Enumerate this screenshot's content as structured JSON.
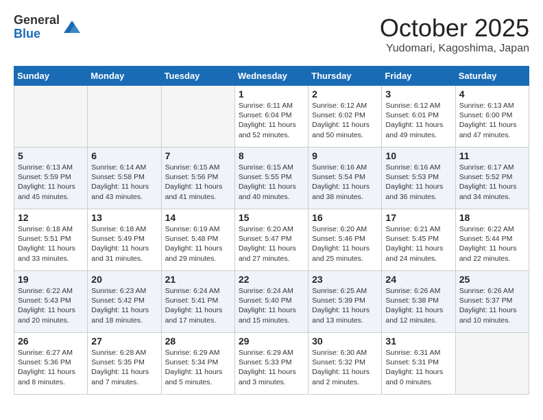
{
  "header": {
    "logo_general": "General",
    "logo_blue": "Blue",
    "month_title": "October 2025",
    "location": "Yudomari, Kagoshima, Japan"
  },
  "days": [
    "Sunday",
    "Monday",
    "Tuesday",
    "Wednesday",
    "Thursday",
    "Friday",
    "Saturday"
  ],
  "weeks": [
    [
      {
        "date": "",
        "sunrise": "",
        "sunset": "",
        "daylight": ""
      },
      {
        "date": "",
        "sunrise": "",
        "sunset": "",
        "daylight": ""
      },
      {
        "date": "",
        "sunrise": "",
        "sunset": "",
        "daylight": ""
      },
      {
        "date": "1",
        "sunrise": "Sunrise: 6:11 AM",
        "sunset": "Sunset: 6:04 PM",
        "daylight": "Daylight: 11 hours and 52 minutes."
      },
      {
        "date": "2",
        "sunrise": "Sunrise: 6:12 AM",
        "sunset": "Sunset: 6:02 PM",
        "daylight": "Daylight: 11 hours and 50 minutes."
      },
      {
        "date": "3",
        "sunrise": "Sunrise: 6:12 AM",
        "sunset": "Sunset: 6:01 PM",
        "daylight": "Daylight: 11 hours and 49 minutes."
      },
      {
        "date": "4",
        "sunrise": "Sunrise: 6:13 AM",
        "sunset": "Sunset: 6:00 PM",
        "daylight": "Daylight: 11 hours and 47 minutes."
      }
    ],
    [
      {
        "date": "5",
        "sunrise": "Sunrise: 6:13 AM",
        "sunset": "Sunset: 5:59 PM",
        "daylight": "Daylight: 11 hours and 45 minutes."
      },
      {
        "date": "6",
        "sunrise": "Sunrise: 6:14 AM",
        "sunset": "Sunset: 5:58 PM",
        "daylight": "Daylight: 11 hours and 43 minutes."
      },
      {
        "date": "7",
        "sunrise": "Sunrise: 6:15 AM",
        "sunset": "Sunset: 5:56 PM",
        "daylight": "Daylight: 11 hours and 41 minutes."
      },
      {
        "date": "8",
        "sunrise": "Sunrise: 6:15 AM",
        "sunset": "Sunset: 5:55 PM",
        "daylight": "Daylight: 11 hours and 40 minutes."
      },
      {
        "date": "9",
        "sunrise": "Sunrise: 6:16 AM",
        "sunset": "Sunset: 5:54 PM",
        "daylight": "Daylight: 11 hours and 38 minutes."
      },
      {
        "date": "10",
        "sunrise": "Sunrise: 6:16 AM",
        "sunset": "Sunset: 5:53 PM",
        "daylight": "Daylight: 11 hours and 36 minutes."
      },
      {
        "date": "11",
        "sunrise": "Sunrise: 6:17 AM",
        "sunset": "Sunset: 5:52 PM",
        "daylight": "Daylight: 11 hours and 34 minutes."
      }
    ],
    [
      {
        "date": "12",
        "sunrise": "Sunrise: 6:18 AM",
        "sunset": "Sunset: 5:51 PM",
        "daylight": "Daylight: 11 hours and 33 minutes."
      },
      {
        "date": "13",
        "sunrise": "Sunrise: 6:18 AM",
        "sunset": "Sunset: 5:49 PM",
        "daylight": "Daylight: 11 hours and 31 minutes."
      },
      {
        "date": "14",
        "sunrise": "Sunrise: 6:19 AM",
        "sunset": "Sunset: 5:48 PM",
        "daylight": "Daylight: 11 hours and 29 minutes."
      },
      {
        "date": "15",
        "sunrise": "Sunrise: 6:20 AM",
        "sunset": "Sunset: 5:47 PM",
        "daylight": "Daylight: 11 hours and 27 minutes."
      },
      {
        "date": "16",
        "sunrise": "Sunrise: 6:20 AM",
        "sunset": "Sunset: 5:46 PM",
        "daylight": "Daylight: 11 hours and 25 minutes."
      },
      {
        "date": "17",
        "sunrise": "Sunrise: 6:21 AM",
        "sunset": "Sunset: 5:45 PM",
        "daylight": "Daylight: 11 hours and 24 minutes."
      },
      {
        "date": "18",
        "sunrise": "Sunrise: 6:22 AM",
        "sunset": "Sunset: 5:44 PM",
        "daylight": "Daylight: 11 hours and 22 minutes."
      }
    ],
    [
      {
        "date": "19",
        "sunrise": "Sunrise: 6:22 AM",
        "sunset": "Sunset: 5:43 PM",
        "daylight": "Daylight: 11 hours and 20 minutes."
      },
      {
        "date": "20",
        "sunrise": "Sunrise: 6:23 AM",
        "sunset": "Sunset: 5:42 PM",
        "daylight": "Daylight: 11 hours and 18 minutes."
      },
      {
        "date": "21",
        "sunrise": "Sunrise: 6:24 AM",
        "sunset": "Sunset: 5:41 PM",
        "daylight": "Daylight: 11 hours and 17 minutes."
      },
      {
        "date": "22",
        "sunrise": "Sunrise: 6:24 AM",
        "sunset": "Sunset: 5:40 PM",
        "daylight": "Daylight: 11 hours and 15 minutes."
      },
      {
        "date": "23",
        "sunrise": "Sunrise: 6:25 AM",
        "sunset": "Sunset: 5:39 PM",
        "daylight": "Daylight: 11 hours and 13 minutes."
      },
      {
        "date": "24",
        "sunrise": "Sunrise: 6:26 AM",
        "sunset": "Sunset: 5:38 PM",
        "daylight": "Daylight: 11 hours and 12 minutes."
      },
      {
        "date": "25",
        "sunrise": "Sunrise: 6:26 AM",
        "sunset": "Sunset: 5:37 PM",
        "daylight": "Daylight: 11 hours and 10 minutes."
      }
    ],
    [
      {
        "date": "26",
        "sunrise": "Sunrise: 6:27 AM",
        "sunset": "Sunset: 5:36 PM",
        "daylight": "Daylight: 11 hours and 8 minutes."
      },
      {
        "date": "27",
        "sunrise": "Sunrise: 6:28 AM",
        "sunset": "Sunset: 5:35 PM",
        "daylight": "Daylight: 11 hours and 7 minutes."
      },
      {
        "date": "28",
        "sunrise": "Sunrise: 6:29 AM",
        "sunset": "Sunset: 5:34 PM",
        "daylight": "Daylight: 11 hours and 5 minutes."
      },
      {
        "date": "29",
        "sunrise": "Sunrise: 6:29 AM",
        "sunset": "Sunset: 5:33 PM",
        "daylight": "Daylight: 11 hours and 3 minutes."
      },
      {
        "date": "30",
        "sunrise": "Sunrise: 6:30 AM",
        "sunset": "Sunset: 5:32 PM",
        "daylight": "Daylight: 11 hours and 2 minutes."
      },
      {
        "date": "31",
        "sunrise": "Sunrise: 6:31 AM",
        "sunset": "Sunset: 5:31 PM",
        "daylight": "Daylight: 11 hours and 0 minutes."
      },
      {
        "date": "",
        "sunrise": "",
        "sunset": "",
        "daylight": ""
      }
    ]
  ]
}
